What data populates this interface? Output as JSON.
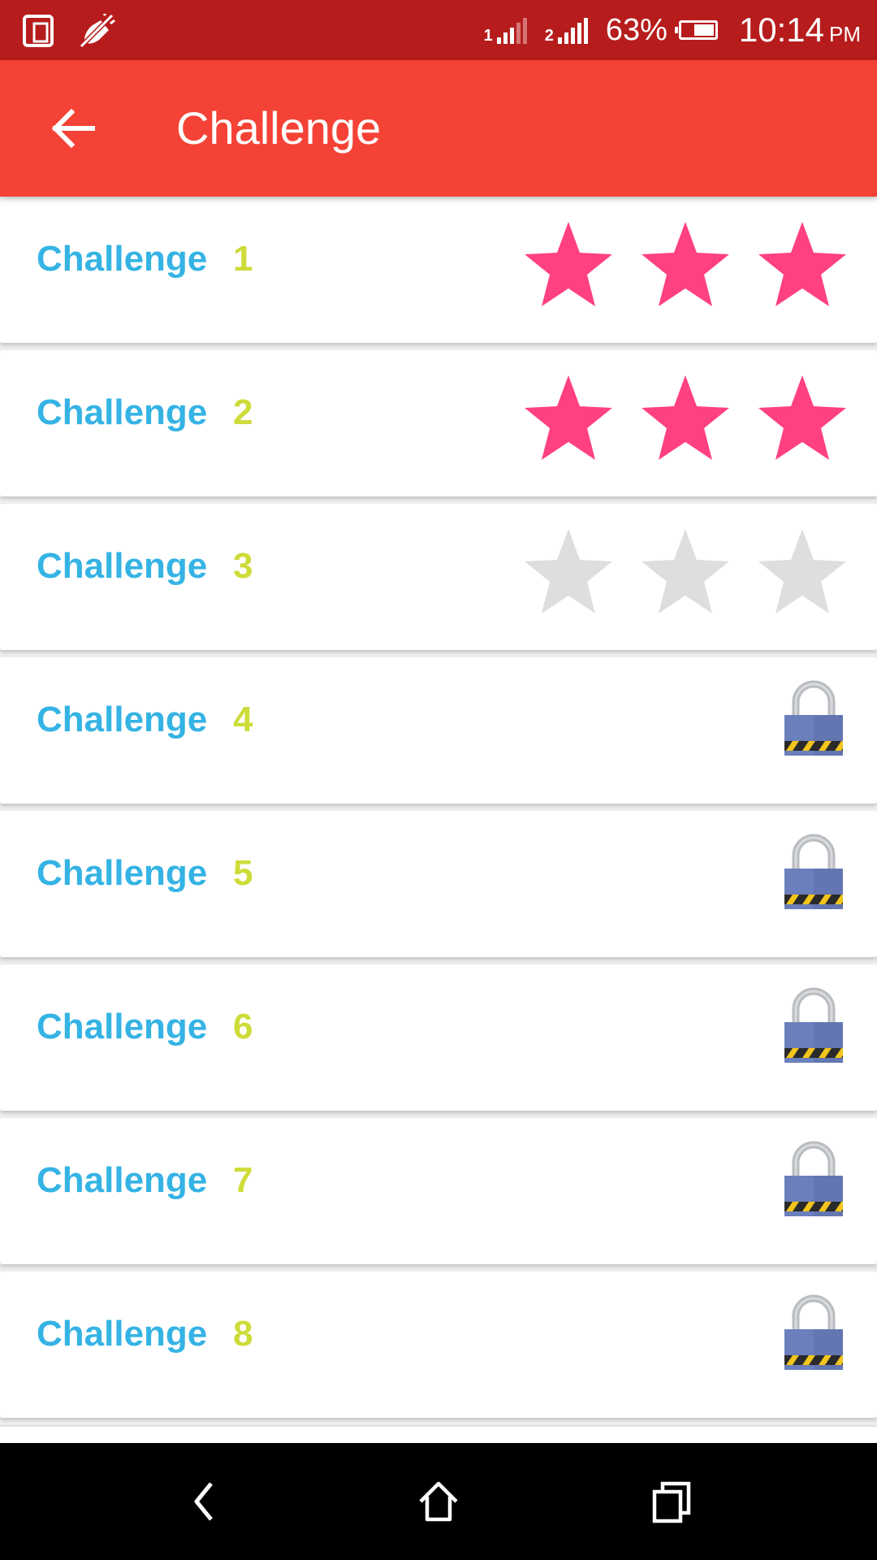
{
  "status_bar": {
    "sim1_label": "1",
    "sim2_label": "2",
    "battery_percent": "63%",
    "battery_level": 0.63,
    "time": "10:14",
    "ampm": "PM",
    "left_icons": [
      "dual-screen-icon",
      "vibrate-off-icon"
    ]
  },
  "app_bar": {
    "title": "Challenge",
    "background": "#f44336",
    "back_icon": "arrow-back-icon"
  },
  "colors": {
    "status_bar": "#b71c1c",
    "label": "#35b3e4",
    "number": "#cddc39",
    "star_earned": "#ff4081",
    "star_empty": "#dedede",
    "lock_body": "#6b7fbc"
  },
  "challenges": [
    {
      "label": "Challenge",
      "number": "1",
      "state": "stars",
      "stars_earned": 3,
      "stars_total": 3
    },
    {
      "label": "Challenge",
      "number": "2",
      "state": "stars",
      "stars_earned": 3,
      "stars_total": 3
    },
    {
      "label": "Challenge",
      "number": "3",
      "state": "stars",
      "stars_earned": 0,
      "stars_total": 3
    },
    {
      "label": "Challenge",
      "number": "4",
      "state": "locked"
    },
    {
      "label": "Challenge",
      "number": "5",
      "state": "locked"
    },
    {
      "label": "Challenge",
      "number": "6",
      "state": "locked"
    },
    {
      "label": "Challenge",
      "number": "7",
      "state": "locked"
    },
    {
      "label": "Challenge",
      "number": "8",
      "state": "locked"
    }
  ],
  "nav_bar": {
    "icons": [
      "nav-back-icon",
      "nav-home-icon",
      "nav-recents-icon"
    ]
  }
}
